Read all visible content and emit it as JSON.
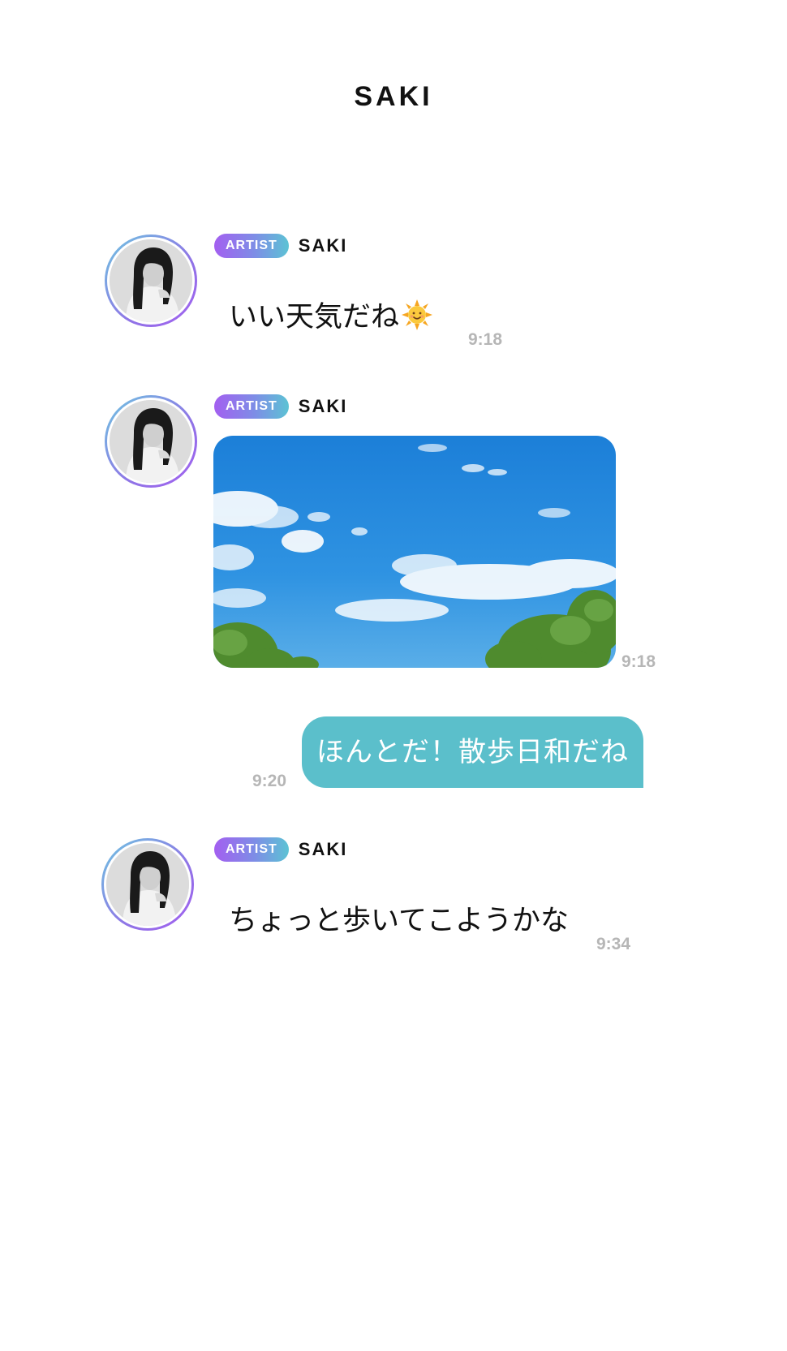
{
  "header": {
    "title": "SAKI"
  },
  "messages": [
    {
      "type": "text",
      "direction": "received",
      "badge": "ARTIST",
      "sender": "SAKI",
      "text": "いい天気だね",
      "emoji": "sun-with-face-icon",
      "time": "9:18"
    },
    {
      "type": "image",
      "direction": "received",
      "badge": "ARTIST",
      "sender": "SAKI",
      "image": "blue-sky-with-clouds-and-trees",
      "time": "9:18"
    },
    {
      "type": "text",
      "direction": "sent",
      "text": "ほんとだ！散歩日和だね",
      "time": "9:20"
    },
    {
      "type": "text",
      "direction": "received",
      "badge": "ARTIST",
      "sender": "SAKI",
      "text": "ちょっと歩いてこようかな",
      "time": "9:34"
    }
  ],
  "colors": {
    "sent_bubble": "#5bbfcb",
    "timestamp": "#b6b6b6",
    "badge_gradient_start": "#a35ff0",
    "badge_gradient_end": "#5cc3d4",
    "text": "#111111"
  }
}
